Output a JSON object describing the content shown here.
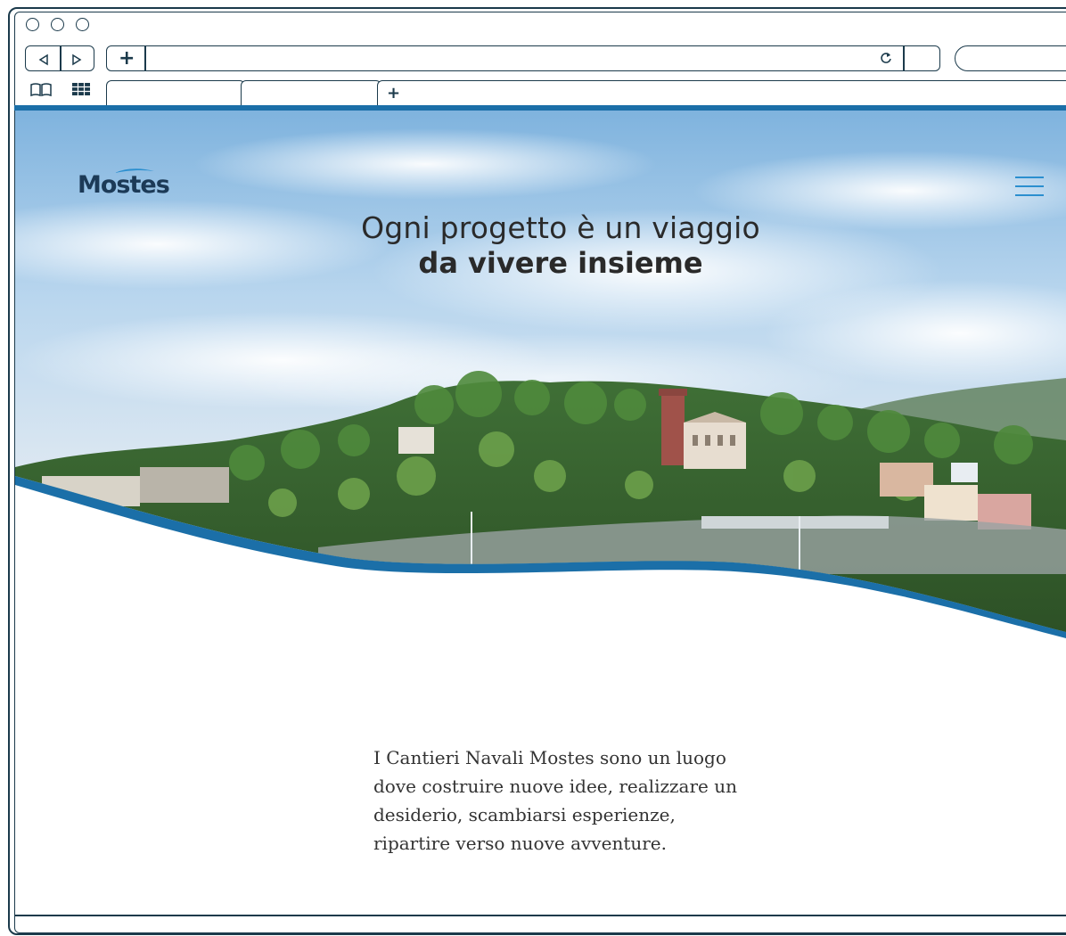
{
  "browser": {
    "tab_new_label": "+",
    "address_new_label": "+",
    "back_icon": "triangle-left-icon",
    "forward_icon": "triangle-right-icon",
    "reload_icon": "reload-icon",
    "bookmarks_icon": "book-icon",
    "grid_icon": "grid-icon"
  },
  "site": {
    "logo_text": "Mostes",
    "menu_icon": "hamburger-icon",
    "hero": {
      "line1": "Ogni progetto è un viaggio",
      "line2": "da vivere insieme"
    },
    "intro_lines": [
      "I Cantieri Navali Mostes sono un luogo",
      "dove costruire nuove idee, realizzare un",
      "desiderio, scambiarsi esperienze,",
      "ripartire verso nuove avventure."
    ]
  },
  "colors": {
    "chrome_stroke": "#1b3a4b",
    "brand_blue": "#1b6fa8",
    "accent_blue": "#2b8fcf",
    "logo_navy": "#1c3a57"
  }
}
